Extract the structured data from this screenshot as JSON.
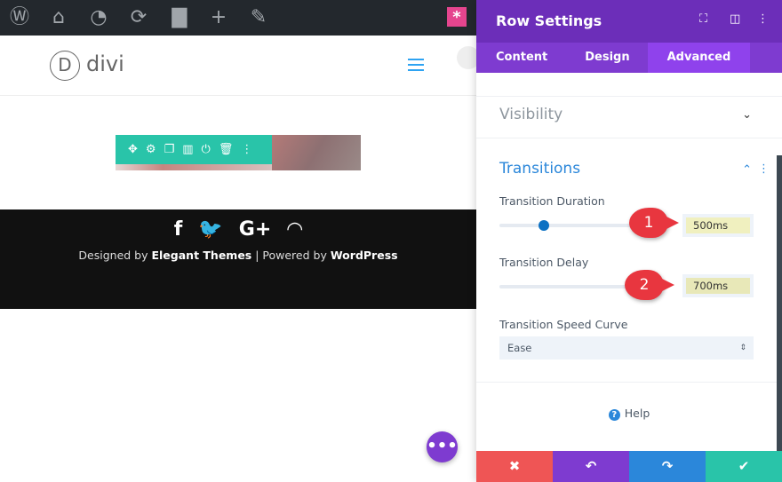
{
  "admin_bar": {
    "icons": [
      "wordpress-icon",
      "my-sites-icon",
      "dashboard-icon",
      "updates-icon",
      "comments-icon",
      "new-icon",
      "edit-icon"
    ]
  },
  "site": {
    "logo_letter": "D",
    "logo_text": "divi"
  },
  "row_toolbar": {
    "icons": [
      "move-icon",
      "settings-icon",
      "duplicate-icon",
      "columns-icon",
      "save-icon",
      "delete-icon",
      "more-icon"
    ]
  },
  "footer": {
    "social": [
      "f",
      "🐦",
      "G+",
      "rss"
    ],
    "credits_prefix": "Designed by ",
    "credits_brand": "Elegant Themes",
    "credits_mid": " | Powered by ",
    "credits_cms": "WordPress"
  },
  "panel": {
    "title": "Row Settings",
    "tabs": [
      "Content",
      "Design",
      "Advanced"
    ],
    "active_tab": "Advanced",
    "visibility_title": "Visibility",
    "transitions_title": "Transitions",
    "duration_label": "Transition Duration",
    "duration_value": "500ms",
    "duration_fraction": 0.28,
    "delay_label": "Transition Delay",
    "delay_value": "700ms",
    "curve_label": "Transition Speed Curve",
    "curve_value": "Ease",
    "help": "Help",
    "annotations": [
      "1",
      "2"
    ]
  },
  "colors": {
    "purple": "#6c2eb9",
    "accent": "#2b87da",
    "teal": "#29c4a9",
    "red": "#ef5555"
  }
}
